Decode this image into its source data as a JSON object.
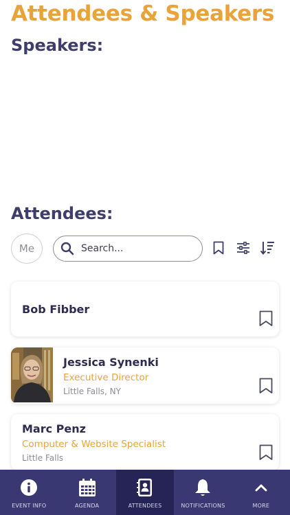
{
  "page": {
    "title": "Attendees & Speakers",
    "speakers_heading": "Speakers:",
    "attendees_heading": "Attendees:"
  },
  "toolbar": {
    "me_label": "Me",
    "search_placeholder": "Search...",
    "bookmark_icon": "bookmark-icon",
    "filter_icon": "sliders-icon",
    "sort_icon": "sort-icon"
  },
  "attendees": [
    {
      "name": "Bob Fibber",
      "title": "",
      "location": "",
      "has_photo": false
    },
    {
      "name": "Jessica Synenki",
      "title": "Executive Director",
      "location": "Little Falls, NY",
      "has_photo": true
    },
    {
      "name": "Marc Penz",
      "title": "Computer & Website Specialist",
      "location": "Little Falls",
      "has_photo": false
    }
  ],
  "tabs": [
    {
      "label": "EVENT INFO",
      "icon": "info-icon",
      "active": false
    },
    {
      "label": "AGENDA",
      "icon": "calendar-icon",
      "active": false
    },
    {
      "label": "ATTENDEES",
      "icon": "contact-book-icon",
      "active": true
    },
    {
      "label": "NOTIFICATIONS",
      "icon": "bell-icon",
      "active": false
    },
    {
      "label": "MORE",
      "icon": "chevron-up-icon",
      "active": false
    }
  ],
  "colors": {
    "accent": "#e8a33a",
    "heading": "#3e3d6b",
    "tabbar": "#3a3872",
    "tabbar_active": "#262457"
  }
}
